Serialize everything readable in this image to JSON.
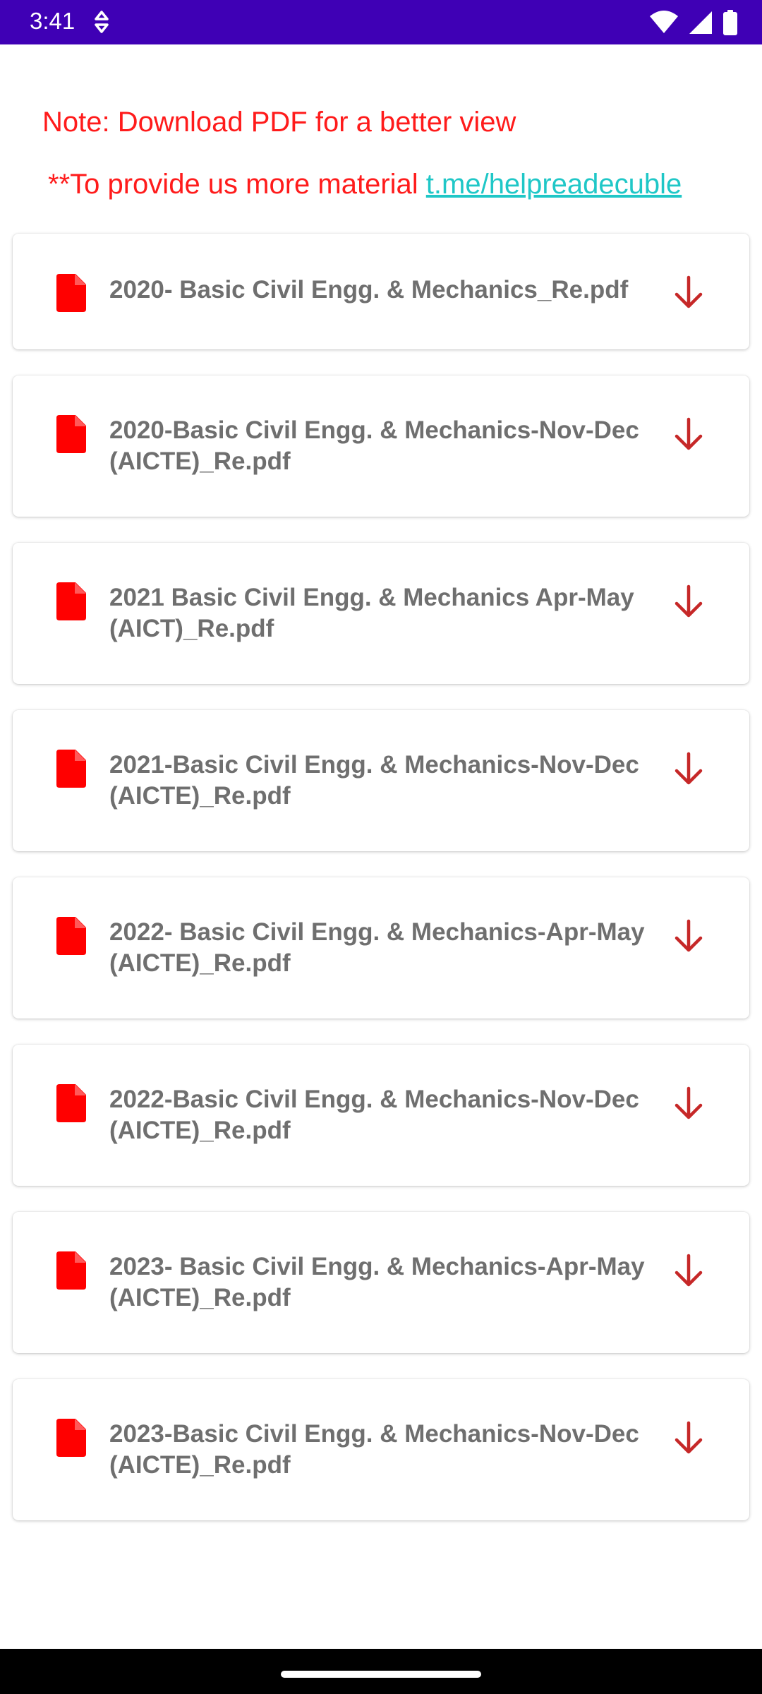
{
  "status_bar": {
    "time": "3:41",
    "icons": [
      "data-saver-icon",
      "wifi-icon",
      "signal-icon",
      "battery-icon"
    ],
    "background": "#3f00b5"
  },
  "note": {
    "text": "Note: Download PDF for a better view",
    "color": "#ff1b1b"
  },
  "provide": {
    "prefix": "**To provide us more material ",
    "link_text": "t.me/helpreadecuble",
    "link_color": "#1fc7c7"
  },
  "files": [
    {
      "name": "2020- Basic Civil Engg. & Mechanics_Re.pdf",
      "icon": "pdf-file-icon",
      "action_icon": "download-arrow-icon"
    },
    {
      "name": "2020-Basic Civil Engg. & Mechanics-Nov-Dec (AICTE)_Re.pdf",
      "icon": "pdf-file-icon",
      "action_icon": "download-arrow-icon"
    },
    {
      "name": "2021  Basic Civil Engg. & Mechanics Apr-May (AICT)_Re.pdf",
      "icon": "pdf-file-icon",
      "action_icon": "download-arrow-icon"
    },
    {
      "name": "2021-Basic Civil Engg. & Mechanics-Nov-Dec (AICTE)_Re.pdf",
      "icon": "pdf-file-icon",
      "action_icon": "download-arrow-icon"
    },
    {
      "name": "2022- Basic Civil Engg. & Mechanics-Apr-May (AICTE)_Re.pdf",
      "icon": "pdf-file-icon",
      "action_icon": "download-arrow-icon"
    },
    {
      "name": "2022-Basic Civil Engg. & Mechanics-Nov-Dec (AICTE)_Re.pdf",
      "icon": "pdf-file-icon",
      "action_icon": "download-arrow-icon"
    },
    {
      "name": "2023- Basic Civil Engg. & Mechanics-Apr-May (AICTE)_Re.pdf",
      "icon": "pdf-file-icon",
      "action_icon": "download-arrow-icon"
    },
    {
      "name": "2023-Basic Civil Engg. & Mechanics-Nov-Dec (AICTE)_Re.pdf",
      "icon": "pdf-file-icon",
      "action_icon": "download-arrow-icon"
    }
  ],
  "colors": {
    "pdf_icon": "#ff0000",
    "download_icon": "#c62828",
    "file_text": "#6f6f6f"
  }
}
